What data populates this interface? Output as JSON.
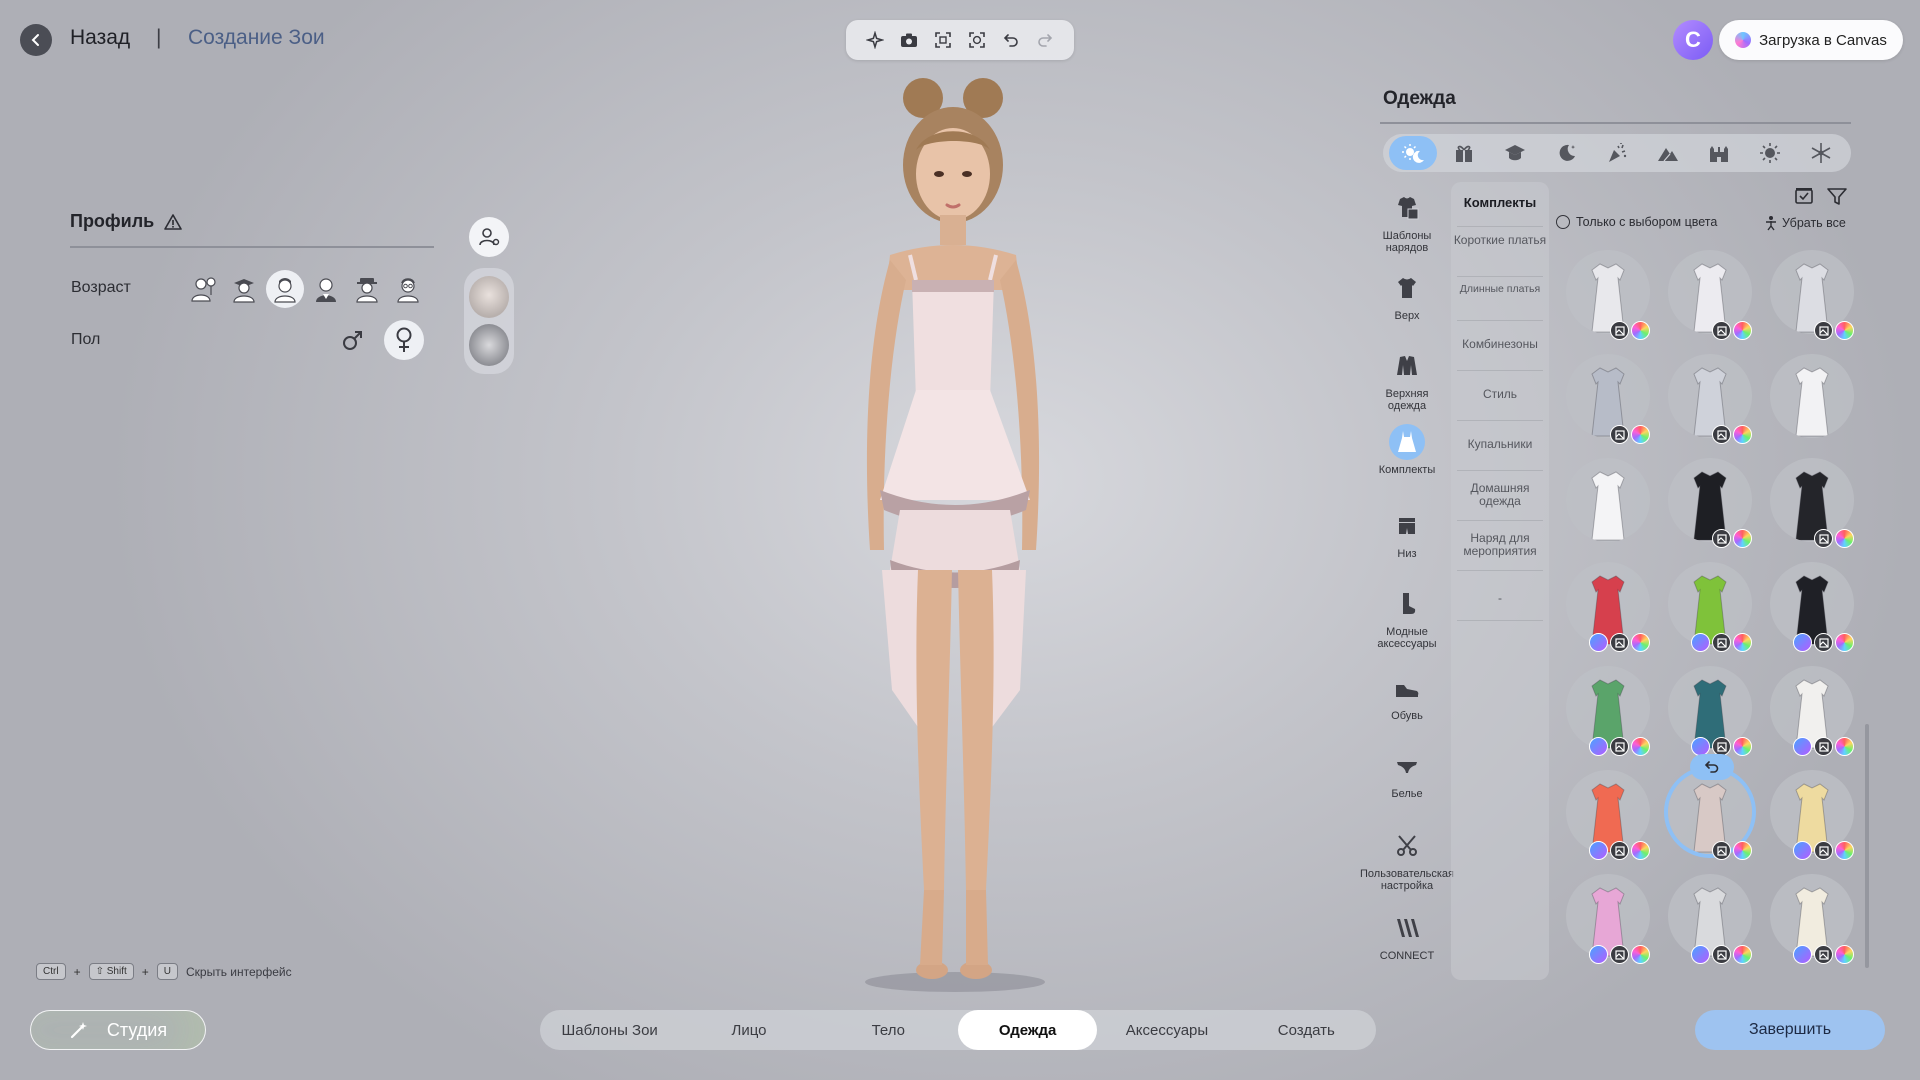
{
  "header": {
    "back_label": "Назад",
    "separator": "|",
    "page_title": "Создание Зои"
  },
  "toolbar": {
    "icons": [
      "sparkle-icon",
      "camera-icon",
      "focus-frame-icon",
      "face-frame-icon",
      "undo-icon",
      "redo-icon"
    ]
  },
  "canvas": {
    "logo_letter": "C",
    "upload_label": "Загрузка в Canvas"
  },
  "profile": {
    "title": "Профиль",
    "age_label": "Возраст",
    "gender_label": "Пол",
    "age_options": [
      "child-icon",
      "student-icon",
      "young-adult-icon",
      "adult-icon",
      "middle-aged-icon",
      "elder-icon"
    ],
    "selected_age_index": 2,
    "selected_gender": "female"
  },
  "hotkey": {
    "keys": [
      "Ctrl",
      "⇧ Shift",
      "U"
    ],
    "plus": "+",
    "label": "Скрыть интерфейс"
  },
  "studio": {
    "label": "Студия"
  },
  "bottom_tabs": {
    "items": [
      "Шаблоны Зои",
      "Лицо",
      "Тело",
      "Одежда",
      "Аксессуары",
      "Создать"
    ],
    "active_index": 3
  },
  "finish": {
    "label": "Завершить"
  },
  "clothing": {
    "title": "Одежда",
    "style_icons": [
      "day-night-icon",
      "gift-icon",
      "graduation-cap-icon",
      "moon-icon",
      "party-popper-icon",
      "mountain-icon",
      "castle-icon",
      "sun-icon",
      "snowflake-icon"
    ],
    "categories": [
      {
        "label": "Шаблоны нарядов",
        "icon": "outfit-templates-icon"
      },
      {
        "label": "Верх",
        "icon": "tshirt-icon"
      },
      {
        "label": "Верхняя одежда",
        "icon": "jacket-icon"
      },
      {
        "label": "Комплекты",
        "icon": "dress-icon"
      },
      {
        "label": "Низ",
        "icon": "shorts-icon"
      },
      {
        "label": "Модные аксессуары",
        "icon": "sock-icon"
      },
      {
        "label": "Обувь",
        "icon": "shoe-icon"
      },
      {
        "label": "Белье",
        "icon": "underwear-icon"
      },
      {
        "label": "Пользовательская настройка",
        "icon": "scissors-icon"
      },
      {
        "label": "CONNECT",
        "icon": "connect-icon"
      }
    ],
    "selected_category_index": 3,
    "subcategories": [
      "Комплекты",
      "Короткие платья",
      "Длинные платья",
      "Комбинезоны",
      "Стиль",
      "Купальники",
      "Домашняя одежда",
      "Наряд для мероприятия",
      "-"
    ],
    "color_only_label": "Только с выбором цвета",
    "remove_all_label": "Убрать все",
    "items": [
      {
        "name": "pajama-set-white",
        "color": "#e8e8ec",
        "badges": [
          "texture",
          "color"
        ]
      },
      {
        "name": "pajama-set-dots",
        "color": "#ecebf0",
        "badges": [
          "texture",
          "color"
        ]
      },
      {
        "name": "pajama-shorts-set",
        "color": "#dcdde3",
        "badges": [
          "texture",
          "color"
        ]
      },
      {
        "name": "pajama-grey-set",
        "color": "#b7bcc8",
        "badges": [
          "texture",
          "color"
        ]
      },
      {
        "name": "pajama-plaid-shorts",
        "color": "#cfd2da",
        "badges": [
          "texture",
          "color"
        ]
      },
      {
        "name": "wedding-gown",
        "color": "#f2f2f4",
        "badges": []
      },
      {
        "name": "white-mini-dress",
        "color": "#f4f4f6",
        "badges": []
      },
      {
        "name": "black-suit",
        "color": "#1e1f24",
        "badges": [
          "texture",
          "color"
        ]
      },
      {
        "name": "black-tuxedo",
        "color": "#24252a",
        "badges": [
          "texture",
          "color"
        ]
      },
      {
        "name": "red-stripe-dress",
        "color": "#d6404d",
        "badges": [
          "bm",
          "texture",
          "color"
        ]
      },
      {
        "name": "green-print-set",
        "color": "#7fc23a",
        "badges": [
          "bm",
          "texture",
          "color"
        ]
      },
      {
        "name": "black-puff-dress",
        "color": "#1f2026",
        "badges": [
          "bm",
          "texture",
          "color"
        ]
      },
      {
        "name": "green-flare-dress",
        "color": "#5aa46a",
        "badges": [
          "bm",
          "texture",
          "color"
        ]
      },
      {
        "name": "teal-wrap-dress",
        "color": "#2f6d78",
        "badges": [
          "bm",
          "texture",
          "color"
        ]
      },
      {
        "name": "white-mermaid-dress",
        "color": "#f1f0ee",
        "badges": [
          "bm",
          "texture",
          "color"
        ]
      },
      {
        "name": "coral-slip-dress",
        "color": "#f06a52",
        "badges": [
          "bm",
          "texture",
          "color"
        ]
      },
      {
        "name": "lace-hi-low-dress",
        "color": "#d8c9c6",
        "badges": [
          "texture",
          "color"
        ],
        "selected": true
      },
      {
        "name": "cream-slip-dress",
        "color": "#eedba0",
        "badges": [
          "bm",
          "texture",
          "color"
        ]
      },
      {
        "name": "pink-top-set",
        "color": "#e7a7d6",
        "badges": [
          "bm",
          "texture",
          "color"
        ]
      },
      {
        "name": "grey-bodysuit",
        "color": "#d9dadd",
        "badges": [
          "bm",
          "texture",
          "color"
        ]
      },
      {
        "name": "cream-romper",
        "color": "#f1ecdf",
        "badges": [
          "bm",
          "texture",
          "color"
        ]
      }
    ]
  }
}
